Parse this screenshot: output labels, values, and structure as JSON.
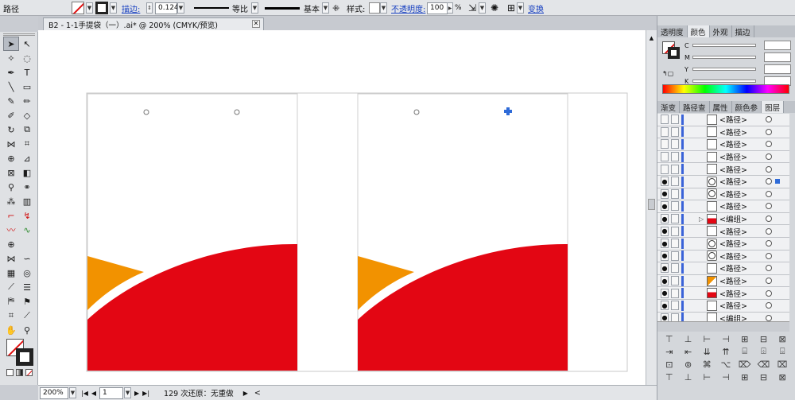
{
  "control_bar": {
    "object_type": "路径",
    "stroke_label": "描边:",
    "stroke_weight": "0.124",
    "profile_label": "等比",
    "brush_label": "基本",
    "style_label": "样式:",
    "opacity_label": "不透明度:",
    "opacity_value": "100",
    "opacity_unit": "%",
    "transform_label": "变换"
  },
  "document": {
    "tab_title": "B2 - 1-1手提袋（一）.ai* @ 200% (CMYK/预览)",
    "close_glyph": "✕"
  },
  "status": {
    "zoom": "200%",
    "page": "1",
    "message": "129 次还原：无重做",
    "nav_first": "|◀",
    "nav_prev": "◀",
    "nav_next": "▶",
    "nav_last": "▶|",
    "scroll_left": "<"
  },
  "panels": {
    "color_tabs": [
      "透明度",
      "颜色",
      "外观",
      "描边"
    ],
    "color_active": "颜色",
    "sliders": [
      "C",
      "M",
      "Y",
      "K"
    ],
    "layers_tabs": [
      "渐变",
      "路径查",
      "属性",
      "颜色参",
      "图层"
    ],
    "layers_active": "图层",
    "layers": [
      {
        "name": "<路径>",
        "visible": false,
        "thumb": "blank"
      },
      {
        "name": "<路径>",
        "visible": false,
        "thumb": "blank"
      },
      {
        "name": "<路径>",
        "visible": false,
        "thumb": "blank"
      },
      {
        "name": "<路径>",
        "visible": false,
        "thumb": "blank"
      },
      {
        "name": "<路径>",
        "visible": false,
        "thumb": "blank"
      },
      {
        "name": "<路径>",
        "visible": true,
        "thumb": "circle",
        "selected": true
      },
      {
        "name": "<路径>",
        "visible": true,
        "thumb": "circle"
      },
      {
        "name": "<路径>",
        "visible": true,
        "thumb": "blank"
      },
      {
        "name": "<编组>",
        "visible": true,
        "thumb": "red",
        "expand": "▷"
      },
      {
        "name": "<路径>",
        "visible": true,
        "thumb": "blank"
      },
      {
        "name": "<路径>",
        "visible": true,
        "thumb": "circle"
      },
      {
        "name": "<路径>",
        "visible": true,
        "thumb": "circle"
      },
      {
        "name": "<路径>",
        "visible": true,
        "thumb": "blank"
      },
      {
        "name": "<路径>",
        "visible": true,
        "thumb": "orange"
      },
      {
        "name": "<路径>",
        "visible": true,
        "thumb": "red"
      },
      {
        "name": "<路径>",
        "visible": true,
        "thumb": "blank"
      },
      {
        "name": "<编组>",
        "visible": true,
        "thumb": "blank"
      }
    ]
  },
  "colors": {
    "red": "#e30613",
    "orange": "#f29200",
    "selection_blue": "#2f6bd8"
  }
}
